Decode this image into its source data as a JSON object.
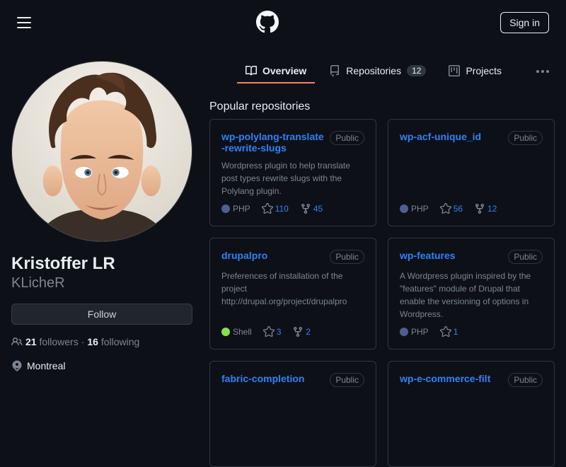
{
  "header": {
    "signin_label": "Sign in"
  },
  "tabs": {
    "overview": "Overview",
    "repositories": "Repositories",
    "repositories_count": "12",
    "projects": "Projects"
  },
  "profile": {
    "fullname": "Kristoffer LR",
    "username": "KLicheR",
    "follow_label": "Follow",
    "followers_count": "21",
    "followers_label": "followers",
    "following_count": "16",
    "following_label": "following",
    "sep": " · ",
    "location": "Montreal"
  },
  "section": {
    "popular_title": "Popular repositories"
  },
  "colors": {
    "php": "#4F5D95",
    "shell": "#89e051"
  },
  "repos": [
    {
      "name": "wp-polylang-translate-rewrite-slugs",
      "visibility": "Public",
      "description": "Wordpress plugin to help translate post types rewrite slugs with the Polylang plugin.",
      "language": "PHP",
      "lang_color": "php",
      "stars": "110",
      "forks": "45"
    },
    {
      "name": "wp-acf-unique_id",
      "visibility": "Public",
      "description": "",
      "language": "PHP",
      "lang_color": "php",
      "stars": "56",
      "forks": "12"
    },
    {
      "name": "drupalpro",
      "visibility": "Public",
      "description": "Preferences of installation of the project http://drupal.org/project/drupalpro",
      "language": "Shell",
      "lang_color": "shell",
      "stars": "3",
      "forks": "2"
    },
    {
      "name": "wp-features",
      "visibility": "Public",
      "description": "A Wordpress plugin inspired by the \"features\" module of Drupal that enable the versioning of options in Wordpress.",
      "language": "PHP",
      "lang_color": "php",
      "stars": "1",
      "forks": ""
    },
    {
      "name": "fabric-completion",
      "visibility": "Public",
      "description": "",
      "language": "",
      "lang_color": "",
      "stars": "",
      "forks": ""
    },
    {
      "name": "wp-e-commerce-filt",
      "visibility": "Public",
      "description": "",
      "language": "",
      "lang_color": "",
      "stars": "",
      "forks": ""
    }
  ]
}
